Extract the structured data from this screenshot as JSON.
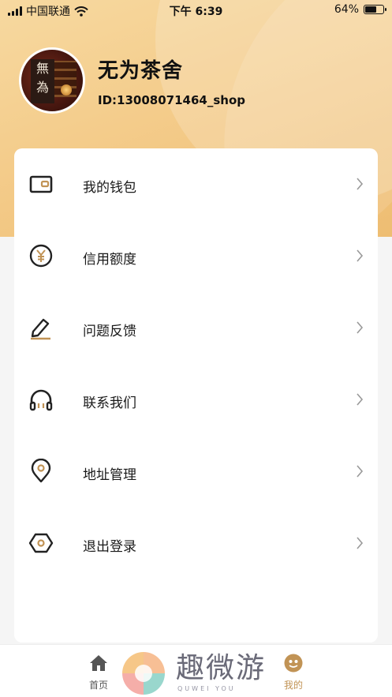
{
  "status_bar": {
    "carrier": "中国联通",
    "time": "下午 6:39",
    "battery_percent": "64%",
    "battery_level": 0.64
  },
  "profile": {
    "shop_name": "无为茶舍",
    "shop_id": "ID:13008071464_shop",
    "avatar_text": "無為"
  },
  "menu": {
    "items": [
      {
        "label": "我的钱包",
        "icon": "wallet-icon"
      },
      {
        "label": "信用额度",
        "icon": "yen-coin-icon"
      },
      {
        "label": "问题反馈",
        "icon": "pencil-icon"
      },
      {
        "label": "联系我们",
        "icon": "headphones-icon"
      },
      {
        "label": "地址管理",
        "icon": "location-pin-icon"
      },
      {
        "label": "退出登录",
        "icon": "logout-hexagon-icon"
      }
    ]
  },
  "tabbar": {
    "home_label": "首页",
    "me_label": "我的",
    "active_color": "#c19355"
  },
  "watermark": {
    "text": "趣微游",
    "subtext": "QUWEI YOU"
  },
  "colors": {
    "accent": "#c19355",
    "header_gradient_start": "#f7d9a0",
    "header_gradient_end": "#eebd72"
  }
}
